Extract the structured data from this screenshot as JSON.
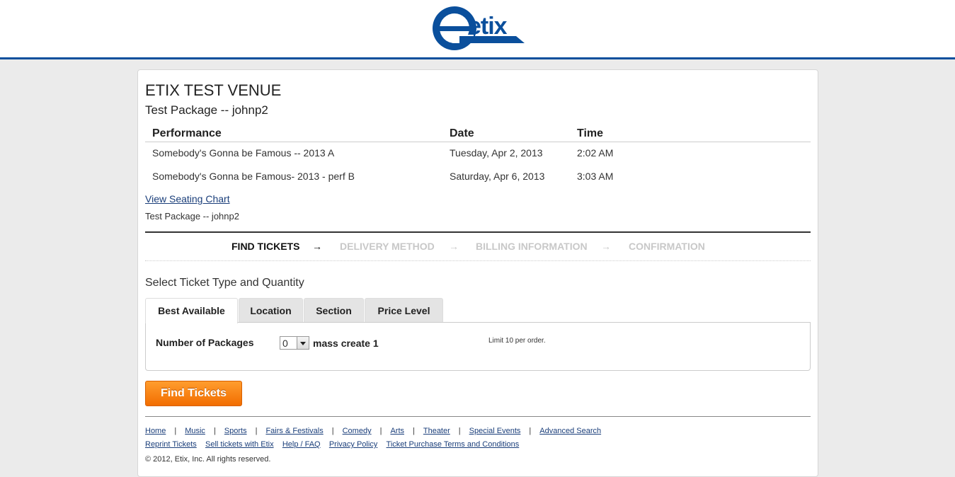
{
  "header": {
    "logo_text": "etix",
    "brand_color": "#0a4f9c"
  },
  "venue": "ETIX TEST VENUE",
  "package_title": "Test Package -- johnp2",
  "performances": {
    "columns": [
      "Performance",
      "Date",
      "Time"
    ],
    "rows": [
      [
        "Somebody's Gonna be Famous -- 2013 A",
        "Tuesday, Apr 2, 2013",
        "2:02 AM"
      ],
      [
        "Somebody's Gonna be Famous- 2013 - perf B",
        "Saturday, Apr 6, 2013",
        "3:03 AM"
      ]
    ]
  },
  "seating_chart_link": "View Seating Chart",
  "package_note": "Test Package -- johnp2",
  "steps": {
    "items": [
      "FIND TICKETS",
      "DELIVERY METHOD",
      "BILLING INFORMATION",
      "CONFIRMATION"
    ],
    "arrow": "→",
    "active_index": 0
  },
  "select_title": "Select Ticket Type and Quantity",
  "tabs": [
    "Best Available",
    "Location",
    "Section",
    "Price Level"
  ],
  "form": {
    "quantity_label": "Number of Packages",
    "quantity_value": "0",
    "package_name": "mass create 1",
    "limit_note": "Limit 10 per order."
  },
  "find_button": "Find Tickets",
  "footer": {
    "row1": [
      "Home",
      "Music",
      "Sports",
      "Fairs & Festivals",
      "Comedy",
      "Arts",
      "Theater",
      "Special Events",
      "Advanced Search"
    ],
    "row2": [
      "Reprint Tickets",
      "Sell tickets with Etix",
      "Help / FAQ",
      "Privacy Policy",
      "Ticket Purchase Terms and Conditions"
    ],
    "separator": "|",
    "copyright": "© 2012, Etix, Inc. All rights reserved."
  },
  "colors": {
    "accent_orange": "#f57f0f",
    "link_blue": "#1a3e7a",
    "inactive_step": "#c8c8c8"
  }
}
